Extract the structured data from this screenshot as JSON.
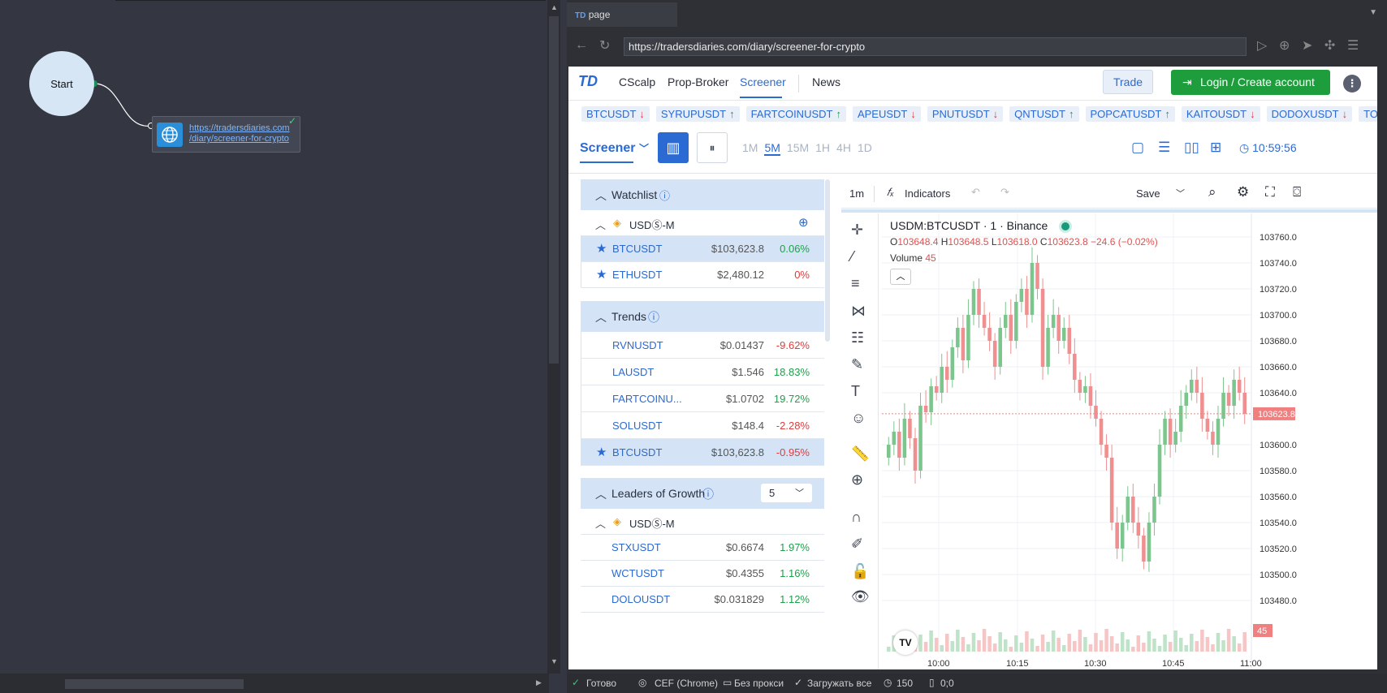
{
  "flow": {
    "start_label": "Start",
    "node_url_line1": "https://tradersdiaries.com",
    "node_url_line2": "/diary/screener-for-crypto"
  },
  "browser": {
    "tab_title": "page",
    "url": "https://tradersdiaries.com/diary/screener-for-crypto"
  },
  "site": {
    "logo": "TD",
    "menu": [
      "CScalp",
      "Prop-Broker",
      "Screener",
      "News"
    ],
    "trade_label": "Trade",
    "login_label": "Login / Create account",
    "ticker": [
      {
        "sym": "BTCUSDT",
        "dir": "↓"
      },
      {
        "sym": "SYRUPUSDT",
        "dir": "↑"
      },
      {
        "sym": "FARTCOINUSDT",
        "dir": "↑"
      },
      {
        "sym": "APEUSDT",
        "dir": "↓"
      },
      {
        "sym": "PNUTUSDT",
        "dir": "↓"
      },
      {
        "sym": "QNTUSDT",
        "dir": "↑"
      },
      {
        "sym": "POPCATUSDT",
        "dir": "↑"
      },
      {
        "sym": "KAITOUSDT",
        "dir": "↓"
      },
      {
        "sym": "DODOXUSDT",
        "dir": "↓"
      },
      {
        "sym": "TON",
        "dir": ""
      }
    ],
    "screener_label": "Screener",
    "timeframes": [
      "1M",
      "5M",
      "15M",
      "1H",
      "4H",
      "1D"
    ],
    "active_tf": "5M",
    "clock": "10:59:56"
  },
  "watchlist": {
    "title": "Watchlist",
    "group": "USDⓈ-M",
    "rows": [
      {
        "sym": "BTCUSDT",
        "price": "$103,623.8",
        "chg": "0.06%",
        "dir": "up",
        "starred": true
      },
      {
        "sym": "ETHUSDT",
        "price": "$2,480.12",
        "chg": "0%",
        "dir": "dn",
        "starred": true
      }
    ]
  },
  "trends": {
    "title": "Trends",
    "rows": [
      {
        "sym": "RVNUSDT",
        "price": "$0.01437",
        "chg": "-9.62%",
        "dir": "dn",
        "starred": false
      },
      {
        "sym": "LAUSDT",
        "price": "$1.546",
        "chg": "18.83%",
        "dir": "up",
        "starred": false
      },
      {
        "sym": "FARTCOINU...",
        "price": "$1.0702",
        "chg": "19.72%",
        "dir": "up",
        "starred": false
      },
      {
        "sym": "SOLUSDT",
        "price": "$148.4",
        "chg": "-2.28%",
        "dir": "dn",
        "starred": false
      },
      {
        "sym": "BTCUSDT",
        "price": "$103,623.8",
        "chg": "-0.95%",
        "dir": "dn",
        "starred": true
      }
    ]
  },
  "leaders": {
    "title": "Leaders of Growth",
    "count": "5",
    "group": "USDⓈ-M",
    "rows": [
      {
        "sym": "STXUSDT",
        "price": "$0.6674",
        "chg": "1.97%",
        "dir": "up"
      },
      {
        "sym": "WCTUSDT",
        "price": "$0.4355",
        "chg": "1.16%",
        "dir": "up"
      },
      {
        "sym": "DOLOUSDT",
        "price": "$0.031829",
        "chg": "1.12%",
        "dir": "up"
      }
    ]
  },
  "chart": {
    "interval": "1m",
    "indicators_label": "Indicators",
    "save_label": "Save",
    "title": "USDM:BTCUSDT · 1 · Binance",
    "ohlc": {
      "o": "103648.4",
      "h": "103648.5",
      "l": "103618.0",
      "c": "103623.8",
      "chg": "−24.6 (−0.02%)"
    },
    "volume_label": "Volume",
    "volume_value": "45",
    "price_ticks": [
      "103760.0",
      "103740.0",
      "103720.0",
      "103700.0",
      "103680.0",
      "103660.0",
      "103640.0",
      "103600.0",
      "103580.0",
      "103560.0",
      "103540.0",
      "103520.0",
      "103500.0",
      "103480.0"
    ],
    "last_price": "103623.8",
    "time_ticks": [
      "10:00",
      "10:15",
      "10:30",
      "10:45",
      "11:00"
    ]
  },
  "status": {
    "ready": "Готово",
    "engine": "CEF (Chrome)",
    "proxy": "Без прокси",
    "load": "Загружать все",
    "count": "150",
    "coords": "0;0"
  }
}
